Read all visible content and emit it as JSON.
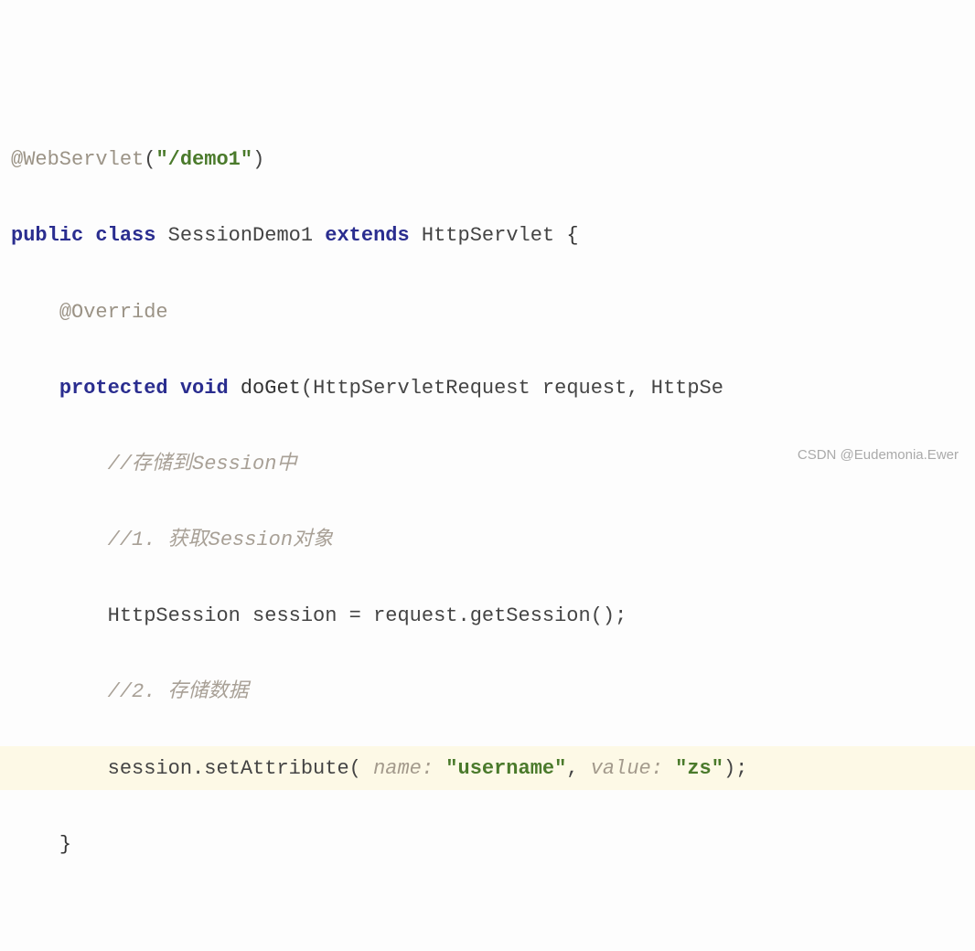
{
  "code": {
    "line1": {
      "annotation": "@WebServlet",
      "paren_open": "(",
      "url": "\"/demo1\"",
      "paren_close": ")"
    },
    "line2": {
      "public": "public",
      "class": "class",
      "classname": "SessionDemo1",
      "extends": "extends",
      "supertype": "HttpServlet",
      "brace": "{"
    },
    "line3": {
      "annotation": "@Override"
    },
    "line4": {
      "protected": "protected",
      "void": "void",
      "method": "doGet",
      "params": "(HttpServletRequest request, HttpSe"
    },
    "line5": {
      "comment": "//存储到Session中"
    },
    "line6": {
      "comment": "//1. 获取Session对象"
    },
    "line7": {
      "stmt": "HttpSession session = request.getSession();"
    },
    "line8": {
      "comment": "//2. 存储数据"
    },
    "line9": {
      "call": "session.setAttribute(",
      "hint1": " name: ",
      "arg1": "\"username\"",
      "comma": ",",
      "hint2": " value: ",
      "arg2": "\"zs\"",
      "end": ");"
    },
    "line10": {
      "brace": "}"
    }
  },
  "watermark": "CSDN @Eudemonia.Ewer"
}
